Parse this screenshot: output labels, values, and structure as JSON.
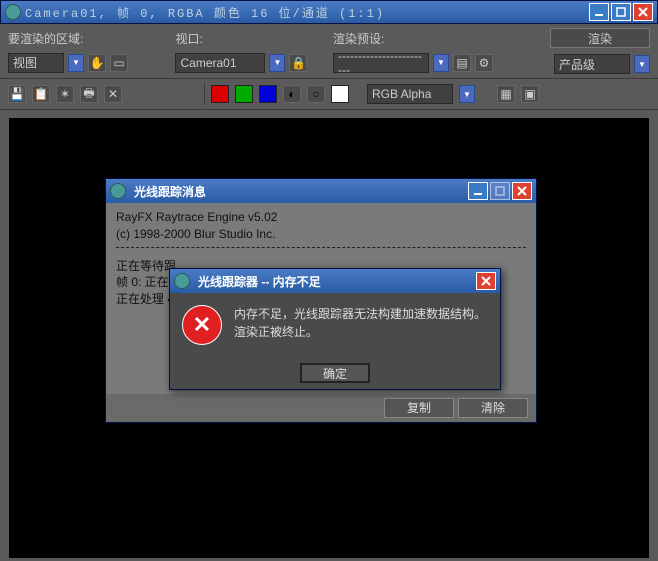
{
  "main_title": "Camera01, 帧 0, RGBA 颜色 16 位/通道 (1:1)",
  "labels": {
    "render_area": "要渲染的区域:",
    "viewport": "视口:",
    "render_preset": "渲染预设:",
    "render_btn": "渲染"
  },
  "dropdowns": {
    "area": "视图",
    "viewport": "Camera01",
    "preset": "------------------------",
    "quality": "产品级",
    "alpha": "RGB Alpha"
  },
  "trace_dialog": {
    "title": "光线跟踪消息",
    "line1": "RayFX Raytrace Engine v5.02",
    "line2": "(c) 1998-2000 Blur Studio Inc.",
    "line3": "正在等待跟",
    "line4": "帧 0: 正在",
    "line5": "正在处理 4",
    "copy": "复制",
    "clear": "清除"
  },
  "error_dialog": {
    "title": "光线跟踪器 -- 内存不足",
    "msg1": "内存不足，光线跟踪器无法构建加速数据结构。",
    "msg2": "渲染正被终止。",
    "ok": "确定"
  }
}
